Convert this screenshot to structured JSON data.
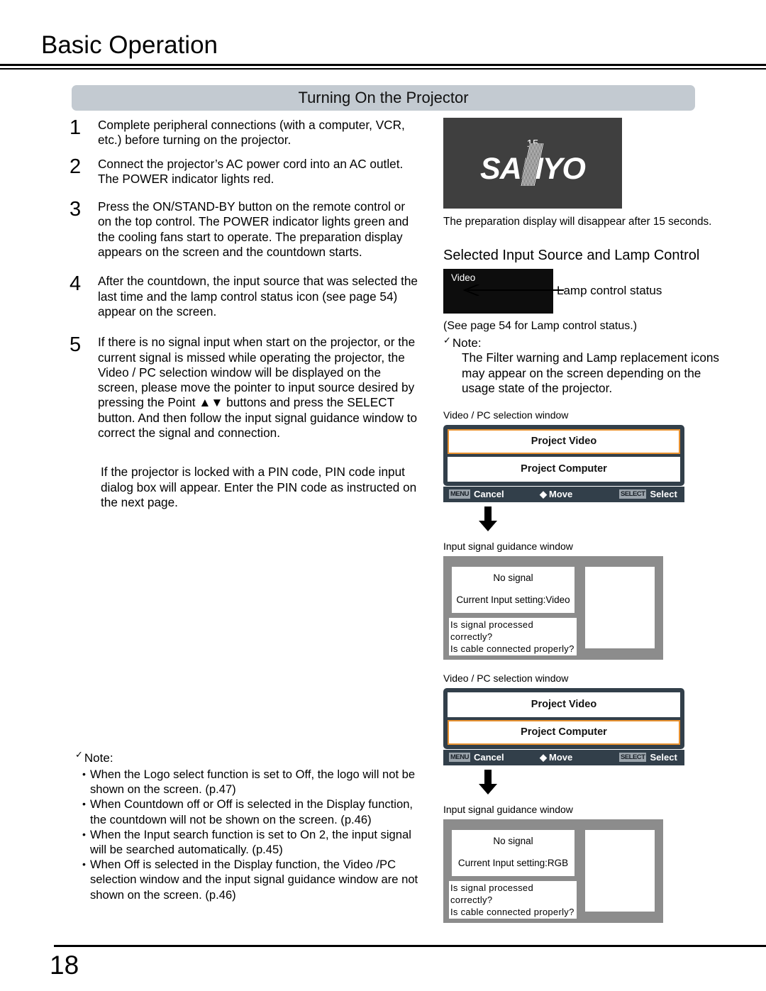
{
  "header": {
    "chapter_title": "Basic Operation",
    "section_title": "Turning On the Projector"
  },
  "steps": [
    {
      "num": "1",
      "text": "Complete peripheral connections (with a computer, VCR, etc.) before turning on the projector."
    },
    {
      "num": "2",
      "text": "Connect the projector’s AC power cord into an AC outlet. The POWER indicator lights red."
    },
    {
      "num": "3",
      "text": "Press the ON/STAND-BY button on the remote control or on the top control. The POWER indicator lights green and the cooling fans start to operate. The preparation display appears on the screen and the countdown starts."
    },
    {
      "num": "4",
      "text": "After the countdown, the input source that was selected the last time and the lamp control status icon (see page 54) appear on the screen."
    },
    {
      "num": "5",
      "text": "If there is no signal input when start on the projector, or the current signal is missed while operating the projector, the Video / PC selection window will be displayed on the screen, please move the pointer to input source desired by pressing the Point ▲▼ buttons and press the SELECT button. And then follow the input signal guidance window to correct the signal and connection."
    }
  ],
  "pin_paragraph": "If the projector is locked with a PIN code, PIN code input dialog box will appear. Enter the PIN code as instructed on the next page.",
  "left_note": {
    "check_icon": "check-icon",
    "heading": "Note:",
    "bullet": "•",
    "items": [
      "When the Logo select function is set to Off, the logo will not be shown on the screen.  (p.47)",
      "When Countdown off   or Off is selected in the Display function, the countdown will not be shown on the screen.  (p.46)",
      "When the Input search function is set to On 2, the input signal will be searched automatically.  (p.45)",
      "When Off is selected in the Display function, the Video /PC selection window and the input signal guidance window are not shown on the screen.  (p.46)"
    ]
  },
  "prep_display": {
    "countdown": "15",
    "logo_a": "SA",
    "logo_n": "N",
    "logo_b": "YO",
    "caption": "The preparation display will disappear after 15 seconds."
  },
  "lamp_section": {
    "heading": "Selected Input Source and Lamp Control",
    "input_label": "Video",
    "callout_label": "Lamp control status",
    "see_page": "(See page 54 for Lamp control status.)",
    "note": {
      "check_icon": "check-icon",
      "heading": "Note:",
      "body": "The Filter warning and Lamp replacement icons may appear on the screen depending on the usage state of the projector."
    }
  },
  "flow": {
    "selection_caption": "Video / PC selection window",
    "guidance_caption": "Input signal guidance window",
    "arrow_icon": "arrow-down-icon",
    "selection_window_1": {
      "options": [
        {
          "label": "Project Video",
          "selected": true
        },
        {
          "label": "Project Computer",
          "selected": false
        }
      ],
      "bar": {
        "menu_key": "MENU",
        "cancel_label": "Cancel",
        "move_icon": "up-down-arrow-icon",
        "move_label": "Move",
        "select_key": "SELECT",
        "select_label": "Select"
      }
    },
    "guidance_window_1": {
      "no_signal": "No signal",
      "current_input": "Current Input setting:Video",
      "question_1": "Is signal processed correctly?",
      "question_2": "Is cable connected properly?"
    },
    "selection_window_2": {
      "options": [
        {
          "label": "Project Video",
          "selected": false
        },
        {
          "label": "Project Computer",
          "selected": true
        }
      ],
      "bar": {
        "menu_key": "MENU",
        "cancel_label": "Cancel",
        "move_icon": "up-down-arrow-icon",
        "move_label": "Move",
        "select_key": "SELECT",
        "select_label": "Select"
      }
    },
    "guidance_window_2": {
      "no_signal": "No signal",
      "current_input": "Current Input setting:RGB",
      "question_1": "Is signal processed correctly?",
      "question_2": "Is cable connected properly?"
    }
  },
  "footer": {
    "page_number": "18"
  },
  "colors": {
    "banner": "#c3cad1",
    "osd_bg": "#323f4a",
    "highlight": "#e8912f",
    "guide_bg": "#8c8c8c",
    "prep_bg": "#3f3f3f"
  }
}
